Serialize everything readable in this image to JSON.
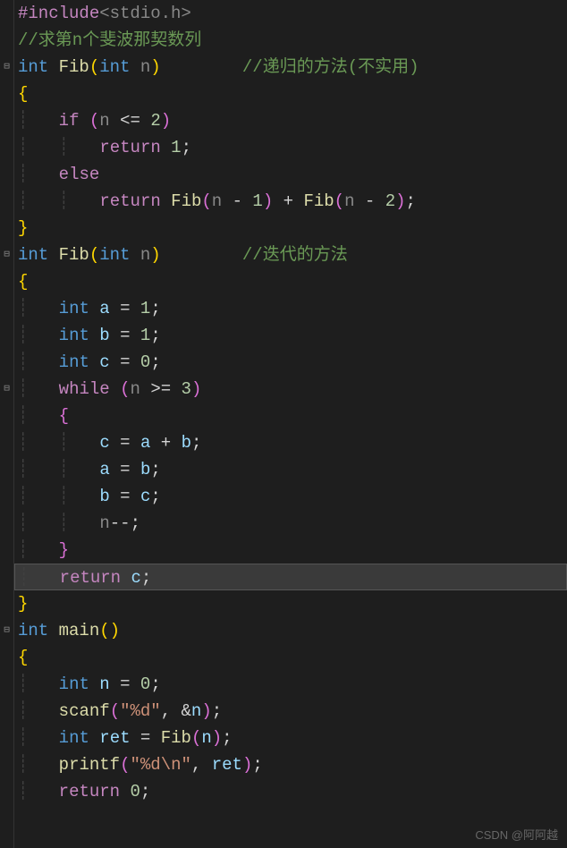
{
  "fold_markers": {
    "collapsed_glyph": "▢",
    "expanded_glyph": "▢",
    "positions": [
      2,
      9,
      14,
      23
    ]
  },
  "code_lines": [
    {
      "indent": 0,
      "tokens": [
        {
          "cls": "preprocessor",
          "t": "#include"
        },
        {
          "cls": "include-path",
          "t": "<stdio.h>"
        }
      ]
    },
    {
      "indent": 0,
      "tokens": [
        {
          "cls": "comment",
          "t": "//求第n个斐波那契数列"
        }
      ]
    },
    {
      "indent": 0,
      "fold": true,
      "tokens": [
        {
          "cls": "keyword-type",
          "t": "int"
        },
        {
          "cls": "punct",
          "t": " "
        },
        {
          "cls": "func-name",
          "t": "Fib"
        },
        {
          "cls": "paren",
          "t": "("
        },
        {
          "cls": "keyword-type",
          "t": "int"
        },
        {
          "cls": "punct",
          "t": " "
        },
        {
          "cls": "param",
          "t": "n"
        },
        {
          "cls": "paren",
          "t": ")"
        },
        {
          "cls": "punct",
          "t": "        "
        },
        {
          "cls": "comment",
          "t": "//递归的方法(不实用)"
        }
      ]
    },
    {
      "indent": 0,
      "tokens": [
        {
          "cls": "paren",
          "t": "{"
        }
      ]
    },
    {
      "indent": 1,
      "tokens": [
        {
          "cls": "keyword-flow",
          "t": "if"
        },
        {
          "cls": "punct",
          "t": " "
        },
        {
          "cls": "paren2",
          "t": "("
        },
        {
          "cls": "param",
          "t": "n"
        },
        {
          "cls": "punct",
          "t": " "
        },
        {
          "cls": "operator",
          "t": "<="
        },
        {
          "cls": "punct",
          "t": " "
        },
        {
          "cls": "number",
          "t": "2"
        },
        {
          "cls": "paren2",
          "t": ")"
        }
      ]
    },
    {
      "indent": 2,
      "tokens": [
        {
          "cls": "keyword-flow",
          "t": "return"
        },
        {
          "cls": "punct",
          "t": " "
        },
        {
          "cls": "number",
          "t": "1"
        },
        {
          "cls": "punct",
          "t": ";"
        }
      ]
    },
    {
      "indent": 1,
      "tokens": [
        {
          "cls": "keyword-flow",
          "t": "else"
        }
      ]
    },
    {
      "indent": 2,
      "tokens": [
        {
          "cls": "keyword-flow",
          "t": "return"
        },
        {
          "cls": "punct",
          "t": " "
        },
        {
          "cls": "func-name",
          "t": "Fib"
        },
        {
          "cls": "paren2",
          "t": "("
        },
        {
          "cls": "param",
          "t": "n"
        },
        {
          "cls": "punct",
          "t": " "
        },
        {
          "cls": "operator",
          "t": "-"
        },
        {
          "cls": "punct",
          "t": " "
        },
        {
          "cls": "number",
          "t": "1"
        },
        {
          "cls": "paren2",
          "t": ")"
        },
        {
          "cls": "punct",
          "t": " "
        },
        {
          "cls": "operator",
          "t": "+"
        },
        {
          "cls": "punct",
          "t": " "
        },
        {
          "cls": "func-name",
          "t": "Fib"
        },
        {
          "cls": "paren2",
          "t": "("
        },
        {
          "cls": "param",
          "t": "n"
        },
        {
          "cls": "punct",
          "t": " "
        },
        {
          "cls": "operator",
          "t": "-"
        },
        {
          "cls": "punct",
          "t": " "
        },
        {
          "cls": "number",
          "t": "2"
        },
        {
          "cls": "paren2",
          "t": ")"
        },
        {
          "cls": "punct",
          "t": ";"
        }
      ]
    },
    {
      "indent": 0,
      "tokens": [
        {
          "cls": "paren",
          "t": "}"
        }
      ]
    },
    {
      "indent": 0,
      "fold": true,
      "tokens": [
        {
          "cls": "keyword-type",
          "t": "int"
        },
        {
          "cls": "punct",
          "t": " "
        },
        {
          "cls": "func-name",
          "t": "Fib"
        },
        {
          "cls": "paren",
          "t": "("
        },
        {
          "cls": "keyword-type",
          "t": "int"
        },
        {
          "cls": "punct",
          "t": " "
        },
        {
          "cls": "param",
          "t": "n"
        },
        {
          "cls": "paren",
          "t": ")"
        },
        {
          "cls": "punct",
          "t": "        "
        },
        {
          "cls": "comment",
          "t": "//迭代的方法"
        }
      ]
    },
    {
      "indent": 0,
      "tokens": [
        {
          "cls": "paren",
          "t": "{"
        }
      ]
    },
    {
      "indent": 1,
      "tokens": [
        {
          "cls": "keyword-type",
          "t": "int"
        },
        {
          "cls": "punct",
          "t": " "
        },
        {
          "cls": "variable",
          "t": "a"
        },
        {
          "cls": "punct",
          "t": " "
        },
        {
          "cls": "operator",
          "t": "="
        },
        {
          "cls": "punct",
          "t": " "
        },
        {
          "cls": "number",
          "t": "1"
        },
        {
          "cls": "punct",
          "t": ";"
        }
      ]
    },
    {
      "indent": 1,
      "tokens": [
        {
          "cls": "keyword-type",
          "t": "int"
        },
        {
          "cls": "punct",
          "t": " "
        },
        {
          "cls": "variable",
          "t": "b"
        },
        {
          "cls": "punct",
          "t": " "
        },
        {
          "cls": "operator",
          "t": "="
        },
        {
          "cls": "punct",
          "t": " "
        },
        {
          "cls": "number",
          "t": "1"
        },
        {
          "cls": "punct",
          "t": ";"
        }
      ]
    },
    {
      "indent": 1,
      "tokens": [
        {
          "cls": "keyword-type",
          "t": "int"
        },
        {
          "cls": "punct",
          "t": " "
        },
        {
          "cls": "variable",
          "t": "c"
        },
        {
          "cls": "punct",
          "t": " "
        },
        {
          "cls": "operator",
          "t": "="
        },
        {
          "cls": "punct",
          "t": " "
        },
        {
          "cls": "number",
          "t": "0"
        },
        {
          "cls": "punct",
          "t": ";"
        }
      ]
    },
    {
      "indent": 1,
      "fold": true,
      "tokens": [
        {
          "cls": "keyword-flow",
          "t": "while"
        },
        {
          "cls": "punct",
          "t": " "
        },
        {
          "cls": "paren2",
          "t": "("
        },
        {
          "cls": "param",
          "t": "n"
        },
        {
          "cls": "punct",
          "t": " "
        },
        {
          "cls": "operator",
          "t": ">="
        },
        {
          "cls": "punct",
          "t": " "
        },
        {
          "cls": "number",
          "t": "3"
        },
        {
          "cls": "paren2",
          "t": ")"
        }
      ]
    },
    {
      "indent": 1,
      "tokens": [
        {
          "cls": "paren2",
          "t": "{"
        }
      ]
    },
    {
      "indent": 2,
      "tokens": [
        {
          "cls": "variable",
          "t": "c"
        },
        {
          "cls": "punct",
          "t": " "
        },
        {
          "cls": "operator",
          "t": "="
        },
        {
          "cls": "punct",
          "t": " "
        },
        {
          "cls": "variable",
          "t": "a"
        },
        {
          "cls": "punct",
          "t": " "
        },
        {
          "cls": "operator",
          "t": "+"
        },
        {
          "cls": "punct",
          "t": " "
        },
        {
          "cls": "variable",
          "t": "b"
        },
        {
          "cls": "punct",
          "t": ";"
        }
      ]
    },
    {
      "indent": 2,
      "tokens": [
        {
          "cls": "variable",
          "t": "a"
        },
        {
          "cls": "punct",
          "t": " "
        },
        {
          "cls": "operator",
          "t": "="
        },
        {
          "cls": "punct",
          "t": " "
        },
        {
          "cls": "variable",
          "t": "b"
        },
        {
          "cls": "punct",
          "t": ";"
        }
      ]
    },
    {
      "indent": 2,
      "tokens": [
        {
          "cls": "variable",
          "t": "b"
        },
        {
          "cls": "punct",
          "t": " "
        },
        {
          "cls": "operator",
          "t": "="
        },
        {
          "cls": "punct",
          "t": " "
        },
        {
          "cls": "variable",
          "t": "c"
        },
        {
          "cls": "punct",
          "t": ";"
        }
      ]
    },
    {
      "indent": 2,
      "tokens": [
        {
          "cls": "param",
          "t": "n"
        },
        {
          "cls": "operator",
          "t": "--"
        },
        {
          "cls": "punct",
          "t": ";"
        }
      ]
    },
    {
      "indent": 1,
      "tokens": [
        {
          "cls": "paren2",
          "t": "}"
        }
      ]
    },
    {
      "indent": 1,
      "highlighted": true,
      "tokens": [
        {
          "cls": "keyword-flow",
          "t": "return"
        },
        {
          "cls": "punct",
          "t": " "
        },
        {
          "cls": "variable",
          "t": "c"
        },
        {
          "cls": "punct",
          "t": ";"
        }
      ]
    },
    {
      "indent": 0,
      "tokens": [
        {
          "cls": "paren",
          "t": "}"
        }
      ]
    },
    {
      "indent": 0,
      "fold": true,
      "tokens": [
        {
          "cls": "keyword-type",
          "t": "int"
        },
        {
          "cls": "punct",
          "t": " "
        },
        {
          "cls": "func-name",
          "t": "main"
        },
        {
          "cls": "paren",
          "t": "()"
        }
      ]
    },
    {
      "indent": 0,
      "tokens": [
        {
          "cls": "paren",
          "t": "{"
        }
      ]
    },
    {
      "indent": 1,
      "tokens": [
        {
          "cls": "keyword-type",
          "t": "int"
        },
        {
          "cls": "punct",
          "t": " "
        },
        {
          "cls": "variable",
          "t": "n"
        },
        {
          "cls": "punct",
          "t": " "
        },
        {
          "cls": "operator",
          "t": "="
        },
        {
          "cls": "punct",
          "t": " "
        },
        {
          "cls": "number",
          "t": "0"
        },
        {
          "cls": "punct",
          "t": ";"
        }
      ]
    },
    {
      "indent": 1,
      "tokens": [
        {
          "cls": "func-name",
          "t": "scanf"
        },
        {
          "cls": "paren2",
          "t": "("
        },
        {
          "cls": "string",
          "t": "\"%d\""
        },
        {
          "cls": "punct",
          "t": ", "
        },
        {
          "cls": "operator",
          "t": "&"
        },
        {
          "cls": "variable",
          "t": "n"
        },
        {
          "cls": "paren2",
          "t": ")"
        },
        {
          "cls": "punct",
          "t": ";"
        }
      ]
    },
    {
      "indent": 1,
      "tokens": [
        {
          "cls": "keyword-type",
          "t": "int"
        },
        {
          "cls": "punct",
          "t": " "
        },
        {
          "cls": "variable",
          "t": "ret"
        },
        {
          "cls": "punct",
          "t": " "
        },
        {
          "cls": "operator",
          "t": "="
        },
        {
          "cls": "punct",
          "t": " "
        },
        {
          "cls": "func-name",
          "t": "Fib"
        },
        {
          "cls": "paren2",
          "t": "("
        },
        {
          "cls": "variable",
          "t": "n"
        },
        {
          "cls": "paren2",
          "t": ")"
        },
        {
          "cls": "punct",
          "t": ";"
        }
      ]
    },
    {
      "indent": 1,
      "tokens": [
        {
          "cls": "func-name",
          "t": "printf"
        },
        {
          "cls": "paren2",
          "t": "("
        },
        {
          "cls": "string",
          "t": "\"%d\\n\""
        },
        {
          "cls": "punct",
          "t": ", "
        },
        {
          "cls": "variable",
          "t": "ret"
        },
        {
          "cls": "paren2",
          "t": ")"
        },
        {
          "cls": "punct",
          "t": ";"
        }
      ]
    },
    {
      "indent": 1,
      "tokens": [
        {
          "cls": "keyword-flow",
          "t": "return"
        },
        {
          "cls": "punct",
          "t": " "
        },
        {
          "cls": "number",
          "t": "0"
        },
        {
          "cls": "punct",
          "t": ";"
        }
      ]
    }
  ],
  "watermark": "CSDN @阿阿越",
  "indent_unit": "    ",
  "guide_char": "┊"
}
